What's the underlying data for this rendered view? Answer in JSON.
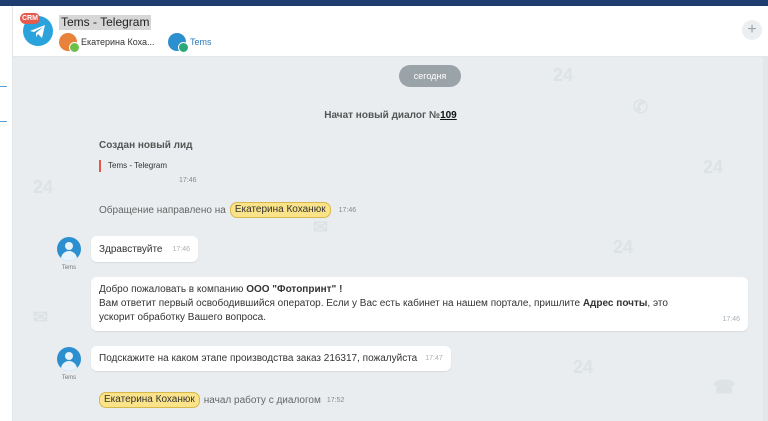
{
  "header": {
    "crm_badge": "CRM",
    "title": "Tems - Telegram",
    "members": [
      {
        "name": "Екатерина Коха..."
      },
      {
        "name": "Tems"
      }
    ],
    "add_button": "+"
  },
  "chat": {
    "date_divider": "сегодня",
    "dialog_started_text": "Начат новый диалог №",
    "dialog_number": "109",
    "lead_title": "Создан новый лид",
    "lead_source": "Tems - Telegram",
    "lead_time": "17:46",
    "routed_text": "Обращение направлено на",
    "routed_to": "Екатерина Коханюк",
    "routed_time": "17:46",
    "operator_name": "Tems",
    "messages": [
      {
        "text": "Здравствуйте",
        "time": "17:46"
      },
      {
        "line1_pre": "Добро пожаловать в компанию ",
        "line1_bold": "ООО \"Фотопринт\" !",
        "line2_pre": "Вам ответит первый освободившийся оператор. Если у Вас есть кабинет на нашем портале, пришлите ",
        "line2_bold": "Адрес почты",
        "line2_post": ", это",
        "line3": "ускорит обработку Вашего вопроса.",
        "time": "17:46"
      },
      {
        "text": "Подскажите на каком этапе производства заказ 216317, пожалуйста",
        "time": "17:47"
      }
    ],
    "work_started_name": "Екатерина Коханюк",
    "work_started_text": "начал работу с диалогом",
    "work_started_time": "17:52"
  },
  "colors": {
    "accent": "#1f3e70",
    "telegram": "#2aa3dc",
    "name_chip": "#fbe38a",
    "lead_marker": "#e05a4a"
  }
}
